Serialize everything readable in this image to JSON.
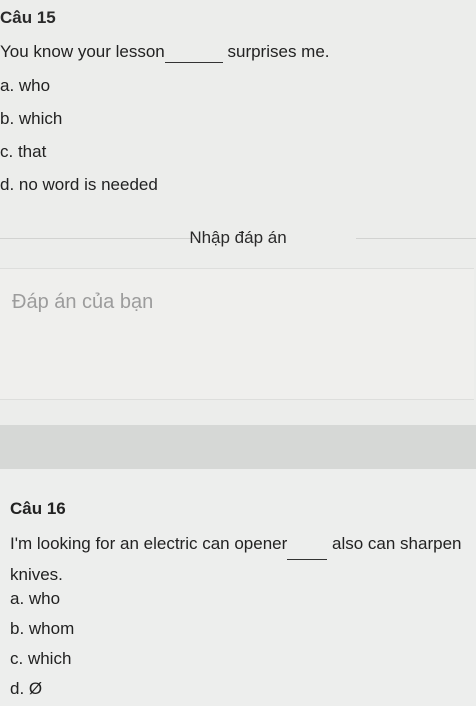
{
  "q15": {
    "title": "Câu 15",
    "stem_before": "You know your lesson",
    "stem_after": " surprises me.",
    "options": [
      "a. who",
      "b. which",
      "c. that",
      "d. no word is needed"
    ]
  },
  "answer_section": {
    "label": "Nhập đáp án",
    "placeholder": "Đáp án của bạn"
  },
  "q16": {
    "title": "Câu 16",
    "stem_before": "I'm looking for an electric can opener",
    "stem_after": " also can sharpen knives.",
    "options": [
      "a. who",
      "b. whom",
      "c. which",
      "d. Ø"
    ]
  }
}
